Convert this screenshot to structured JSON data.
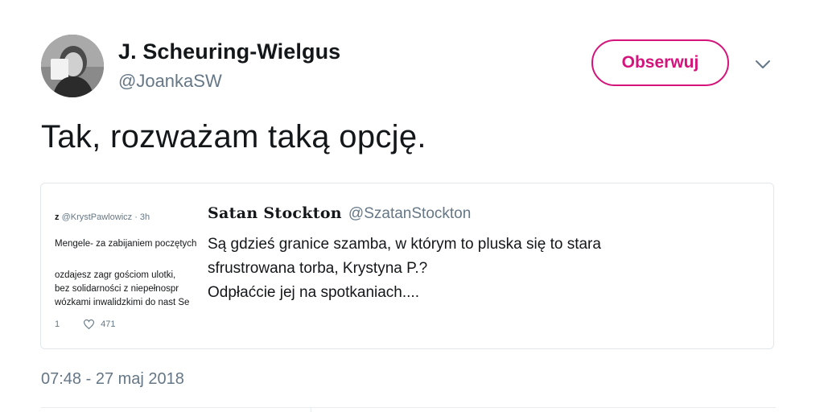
{
  "author": {
    "name": "J. Scheuring-Wielgus",
    "handle": "@JoankaSW",
    "avatar_icon": "profile-photo"
  },
  "follow_button": {
    "label": "Obserwuj",
    "color": "#d4147b"
  },
  "menu": {
    "icon": "chevron-down-icon"
  },
  "tweet": {
    "text": "Tak, rozważam taką opcję."
  },
  "quoted_tweet": {
    "author_name": "Satan Stockton",
    "author_handle": "@SzatanStockton",
    "lines": [
      "Są gdzieś granice szamba, w którym to pluska się to stara",
      "sfrustrowana torba, Krystyna P.?",
      "Odpłaćcie jej na spotkaniach...."
    ],
    "thumbnail": {
      "header_name": "z",
      "header_meta": "@KrystPawlowicz · 3h",
      "line1": "Mengele- za zabijaniem poczętych",
      "line2": "ozdajesz zagr gościom ulotki,",
      "line3": "bez solidarności z niepełnospr",
      "line4": "wózkami inwalidzkimi do nast Se",
      "reply_count": "1",
      "like_count": "471"
    }
  },
  "timestamp": "07:48 - 27 maj 2018"
}
